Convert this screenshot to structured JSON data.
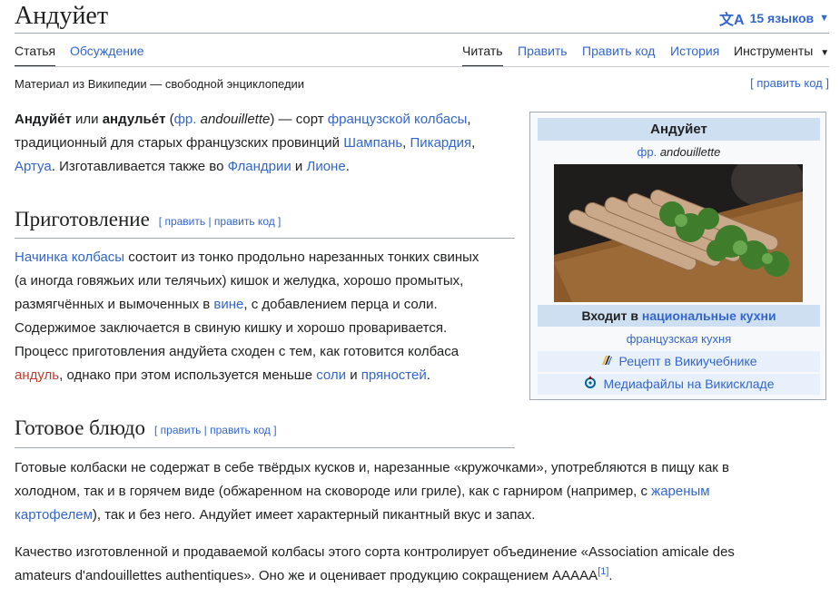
{
  "page": {
    "title": "Андуйет",
    "languages_label": "15 языков",
    "tagline": "Материал из Википедии — свободной энциклопедии",
    "edit_top_label": "[ править код ]"
  },
  "tabs": {
    "article": "Статья",
    "talk": "Обсуждение",
    "read": "Читать",
    "edit": "Править",
    "edit_source": "Править код",
    "history": "История",
    "tools": "Инструменты"
  },
  "intro": {
    "term1": "Андуйе́т",
    "or": " или ",
    "term2": "андулье́т",
    "open": " (",
    "lang": "фр.",
    "original": " andouillette",
    "close": ") — сорт ",
    "link_sausage": "французской колбасы",
    "line1_end": ",",
    "line2_start": "традиционный для старых французских провинций ",
    "link_champagne": "Шампань",
    "comma1": ", ",
    "link_picardie": "Пикардия",
    "comma2": ",",
    "link_artois": "Артуа",
    "mid": ". Изготавливается также во ",
    "link_flanders": "Фландрии",
    "and": " и ",
    "link_lyon": "Лионе",
    "end": "."
  },
  "section1": {
    "heading": "Приготовление",
    "edit_links": "[ править | править код ]",
    "link_filling": "Начинка колбасы",
    "l1": " состоит из тонко продольно нарезанных тонких свиных",
    "l2": "(а иногда говяжьих или телячьих) кишок и желудка, хорошо промытых,",
    "l3a": "размягчённых и вымоченных в ",
    "link_wine": "вине",
    "l3b": ", с добавлением перца и соли.",
    "l4": "Содержимое заключается в свиную кишку и хорошо проваривается.",
    "l5": "Процесс приготовления андуйета сходен с тем, как готовится колбаса",
    "link_andouille": "андуль",
    "l6a": ", однако при этом используется меньше ",
    "link_salt": "соли",
    "l6b": " и ",
    "link_spices": "пряностей",
    "l6c": "."
  },
  "section2": {
    "heading": "Готовое блюдо",
    "edit_links": "[ править | править код ]",
    "p1_l1": "Готовые колбаски не содержат в себе твёрдых кусков и, нарезанные «кружочками», употребляются в пищу как в",
    "p1_l2a": "холодном, так и в горячем виде (обжаренном на сковороде или гриле), как с гарниром (например, с ",
    "link_fried": "жареным",
    "link_potato": "картофелем",
    "p1_l3": "), так и без него. Андуйет имеет характерный пикантный вкус и запах.",
    "p2_l1": "Качество изготовленной и продаваемой колбасы этого сорта контролирует объединение «Association amicale des",
    "p2_l2": "amateurs d'andouillettes authentiques». Оно же и оценивает продукцию сокращением AAAAA",
    "ref": "[1]",
    "p2_end": "."
  },
  "infobox": {
    "title": "Андуйет",
    "sub_lang": "фр.",
    "sub_name": " andouillette",
    "in_label": "Входит в ",
    "in_link": "национальные кухни",
    "cuisine": "французская кухня",
    "recipe": "Рецепт в Викиучебнике",
    "media": "Медиафайлы на Викискладе"
  }
}
